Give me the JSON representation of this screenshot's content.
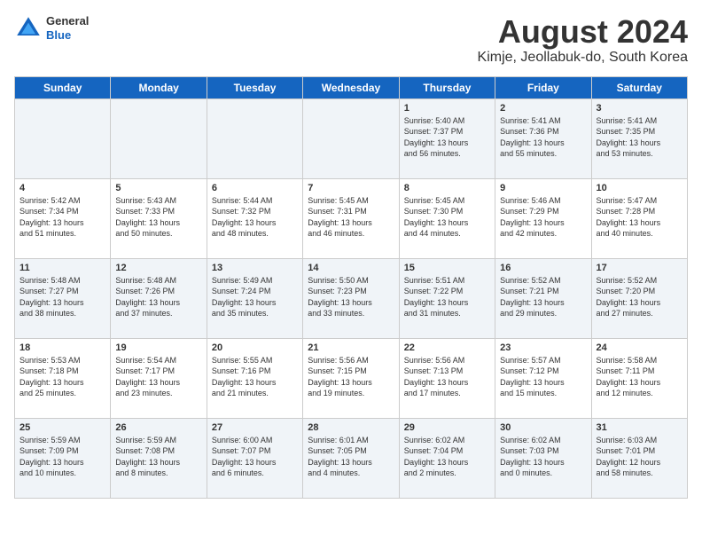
{
  "header": {
    "logo_general": "General",
    "logo_blue": "Blue",
    "title": "August 2024",
    "subtitle": "Kimje, Jeollabuk-do, South Korea"
  },
  "days_of_week": [
    "Sunday",
    "Monday",
    "Tuesday",
    "Wednesday",
    "Thursday",
    "Friday",
    "Saturday"
  ],
  "weeks": [
    [
      {
        "day": "",
        "info": ""
      },
      {
        "day": "",
        "info": ""
      },
      {
        "day": "",
        "info": ""
      },
      {
        "day": "",
        "info": ""
      },
      {
        "day": "1",
        "info": "Sunrise: 5:40 AM\nSunset: 7:37 PM\nDaylight: 13 hours\nand 56 minutes."
      },
      {
        "day": "2",
        "info": "Sunrise: 5:41 AM\nSunset: 7:36 PM\nDaylight: 13 hours\nand 55 minutes."
      },
      {
        "day": "3",
        "info": "Sunrise: 5:41 AM\nSunset: 7:35 PM\nDaylight: 13 hours\nand 53 minutes."
      }
    ],
    [
      {
        "day": "4",
        "info": "Sunrise: 5:42 AM\nSunset: 7:34 PM\nDaylight: 13 hours\nand 51 minutes."
      },
      {
        "day": "5",
        "info": "Sunrise: 5:43 AM\nSunset: 7:33 PM\nDaylight: 13 hours\nand 50 minutes."
      },
      {
        "day": "6",
        "info": "Sunrise: 5:44 AM\nSunset: 7:32 PM\nDaylight: 13 hours\nand 48 minutes."
      },
      {
        "day": "7",
        "info": "Sunrise: 5:45 AM\nSunset: 7:31 PM\nDaylight: 13 hours\nand 46 minutes."
      },
      {
        "day": "8",
        "info": "Sunrise: 5:45 AM\nSunset: 7:30 PM\nDaylight: 13 hours\nand 44 minutes."
      },
      {
        "day": "9",
        "info": "Sunrise: 5:46 AM\nSunset: 7:29 PM\nDaylight: 13 hours\nand 42 minutes."
      },
      {
        "day": "10",
        "info": "Sunrise: 5:47 AM\nSunset: 7:28 PM\nDaylight: 13 hours\nand 40 minutes."
      }
    ],
    [
      {
        "day": "11",
        "info": "Sunrise: 5:48 AM\nSunset: 7:27 PM\nDaylight: 13 hours\nand 38 minutes."
      },
      {
        "day": "12",
        "info": "Sunrise: 5:48 AM\nSunset: 7:26 PM\nDaylight: 13 hours\nand 37 minutes."
      },
      {
        "day": "13",
        "info": "Sunrise: 5:49 AM\nSunset: 7:24 PM\nDaylight: 13 hours\nand 35 minutes."
      },
      {
        "day": "14",
        "info": "Sunrise: 5:50 AM\nSunset: 7:23 PM\nDaylight: 13 hours\nand 33 minutes."
      },
      {
        "day": "15",
        "info": "Sunrise: 5:51 AM\nSunset: 7:22 PM\nDaylight: 13 hours\nand 31 minutes."
      },
      {
        "day": "16",
        "info": "Sunrise: 5:52 AM\nSunset: 7:21 PM\nDaylight: 13 hours\nand 29 minutes."
      },
      {
        "day": "17",
        "info": "Sunrise: 5:52 AM\nSunset: 7:20 PM\nDaylight: 13 hours\nand 27 minutes."
      }
    ],
    [
      {
        "day": "18",
        "info": "Sunrise: 5:53 AM\nSunset: 7:18 PM\nDaylight: 13 hours\nand 25 minutes."
      },
      {
        "day": "19",
        "info": "Sunrise: 5:54 AM\nSunset: 7:17 PM\nDaylight: 13 hours\nand 23 minutes."
      },
      {
        "day": "20",
        "info": "Sunrise: 5:55 AM\nSunset: 7:16 PM\nDaylight: 13 hours\nand 21 minutes."
      },
      {
        "day": "21",
        "info": "Sunrise: 5:56 AM\nSunset: 7:15 PM\nDaylight: 13 hours\nand 19 minutes."
      },
      {
        "day": "22",
        "info": "Sunrise: 5:56 AM\nSunset: 7:13 PM\nDaylight: 13 hours\nand 17 minutes."
      },
      {
        "day": "23",
        "info": "Sunrise: 5:57 AM\nSunset: 7:12 PM\nDaylight: 13 hours\nand 15 minutes."
      },
      {
        "day": "24",
        "info": "Sunrise: 5:58 AM\nSunset: 7:11 PM\nDaylight: 13 hours\nand 12 minutes."
      }
    ],
    [
      {
        "day": "25",
        "info": "Sunrise: 5:59 AM\nSunset: 7:09 PM\nDaylight: 13 hours\nand 10 minutes."
      },
      {
        "day": "26",
        "info": "Sunrise: 5:59 AM\nSunset: 7:08 PM\nDaylight: 13 hours\nand 8 minutes."
      },
      {
        "day": "27",
        "info": "Sunrise: 6:00 AM\nSunset: 7:07 PM\nDaylight: 13 hours\nand 6 minutes."
      },
      {
        "day": "28",
        "info": "Sunrise: 6:01 AM\nSunset: 7:05 PM\nDaylight: 13 hours\nand 4 minutes."
      },
      {
        "day": "29",
        "info": "Sunrise: 6:02 AM\nSunset: 7:04 PM\nDaylight: 13 hours\nand 2 minutes."
      },
      {
        "day": "30",
        "info": "Sunrise: 6:02 AM\nSunset: 7:03 PM\nDaylight: 13 hours\nand 0 minutes."
      },
      {
        "day": "31",
        "info": "Sunrise: 6:03 AM\nSunset: 7:01 PM\nDaylight: 12 hours\nand 58 minutes."
      }
    ]
  ]
}
